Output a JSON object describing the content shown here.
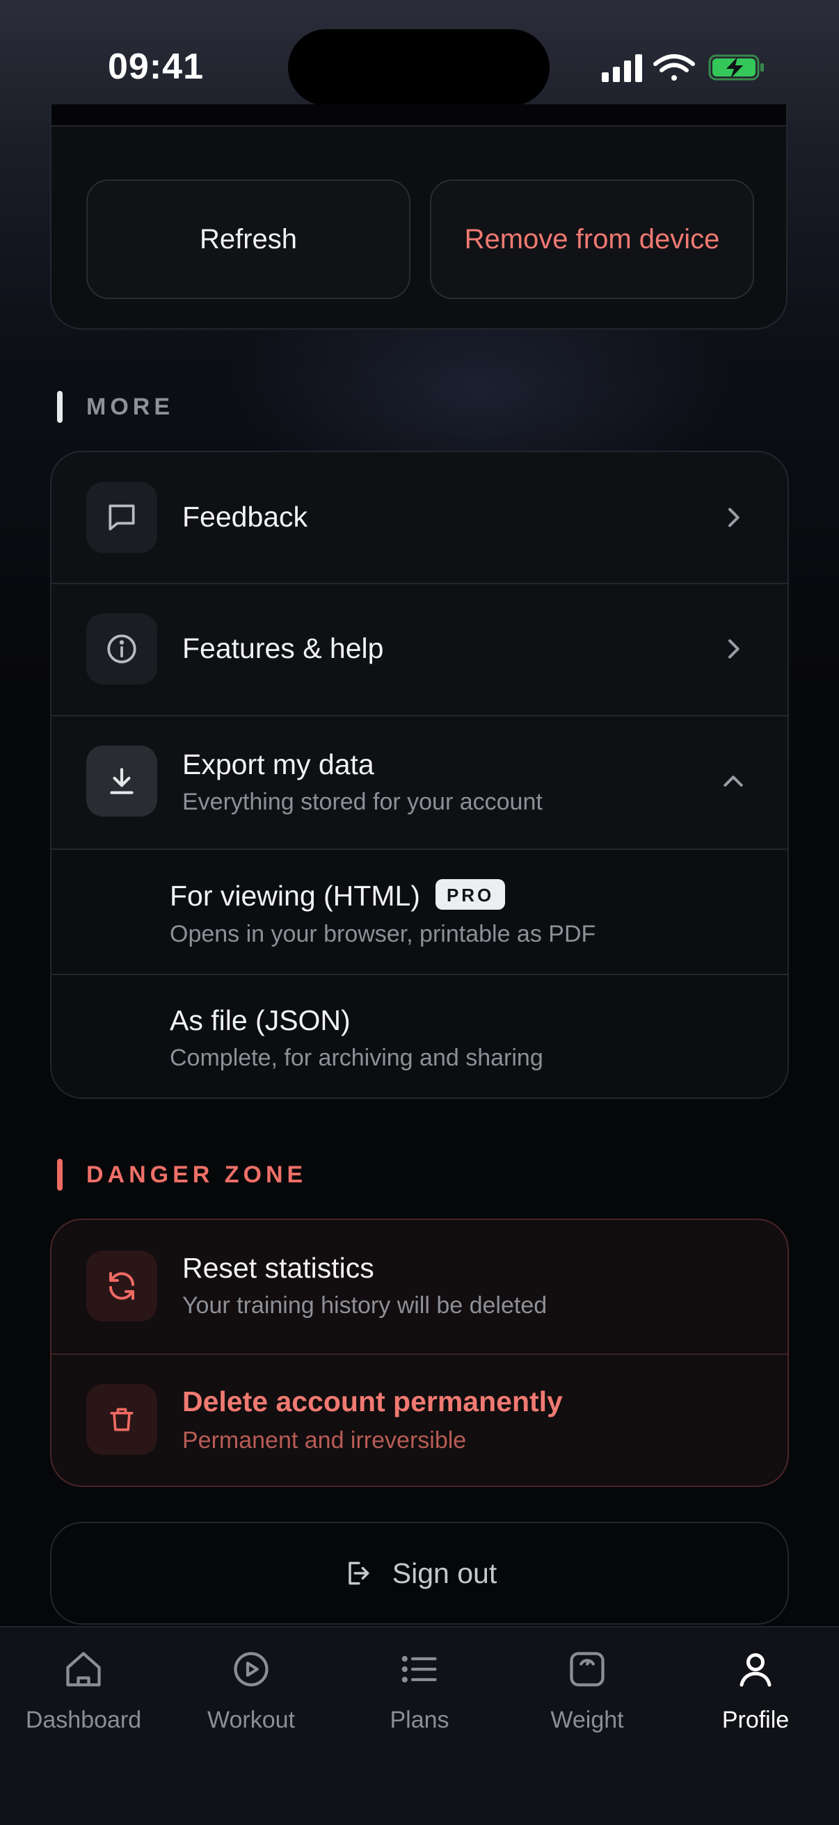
{
  "status_bar": {
    "time": "09:41"
  },
  "top_card": {
    "refresh_label": "Refresh",
    "remove_label": "Remove from device"
  },
  "more_section": {
    "title": "MORE",
    "items": [
      {
        "icon": "message-square-icon",
        "label": "Feedback"
      },
      {
        "icon": "info-circle-icon",
        "label": "Features & help"
      },
      {
        "icon": "download-icon",
        "label": "Export my data",
        "subtitle": "Everything stored for your account",
        "expanded": true
      }
    ],
    "export_options": [
      {
        "label": "For viewing (HTML)",
        "badge": "PRO",
        "subtitle": "Opens in your browser, printable as PDF"
      },
      {
        "label": "As file (JSON)",
        "subtitle": "Complete, for archiving and sharing"
      }
    ]
  },
  "danger_section": {
    "title": "DANGER ZONE",
    "items": [
      {
        "icon": "refresh-icon",
        "label": "Reset statistics",
        "subtitle": "Your training history will be deleted"
      },
      {
        "icon": "trash-icon",
        "label": "Delete account permanently",
        "subtitle": "Permanent and irreversible"
      }
    ]
  },
  "sign_out": {
    "label": "Sign out"
  },
  "tab_bar": {
    "active": "Profile",
    "tabs": [
      {
        "icon": "home-icon",
        "label": "Dashboard"
      },
      {
        "icon": "play-circle-icon",
        "label": "Workout"
      },
      {
        "icon": "list-icon",
        "label": "Plans"
      },
      {
        "icon": "scale-icon",
        "label": "Weight"
      },
      {
        "icon": "user-icon",
        "label": "Profile"
      }
    ]
  },
  "colors": {
    "accent_danger": "#f07a72",
    "background": "#060709",
    "card": "#0f1014"
  }
}
